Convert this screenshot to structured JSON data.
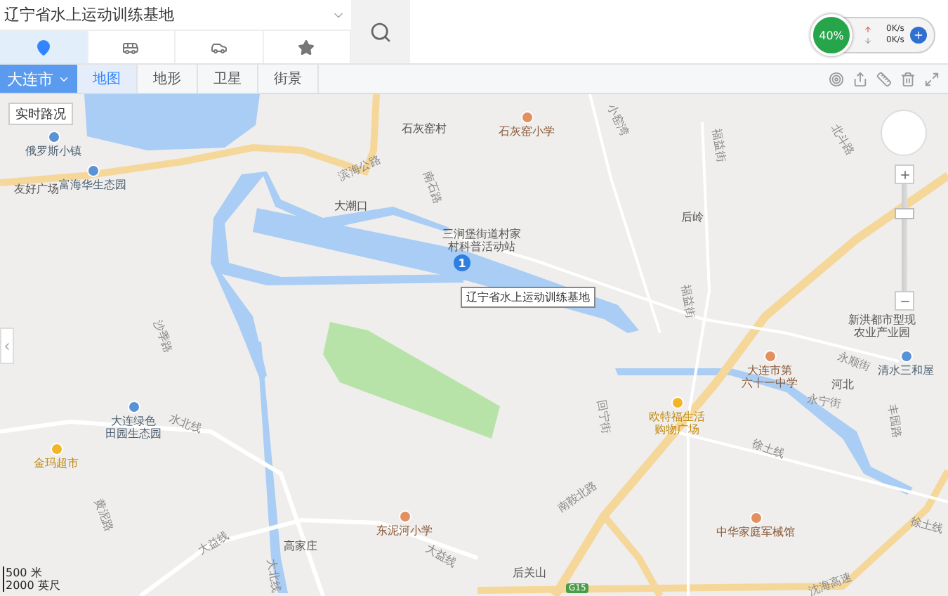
{
  "search": {
    "value": "辽宁省水上运动训练基地"
  },
  "modes": [
    {
      "kind": "pin",
      "selected": true
    },
    {
      "kind": "bus",
      "selected": false
    },
    {
      "kind": "car",
      "selected": false
    },
    {
      "kind": "star",
      "selected": false
    }
  ],
  "city": "大连市",
  "map_types": [
    {
      "label": "地图",
      "selected": true
    },
    {
      "label": "地形",
      "selected": false
    },
    {
      "label": "卫星",
      "selected": false
    },
    {
      "label": "街景",
      "selected": false
    }
  ],
  "traffic_button": "实时路况",
  "monitor": {
    "usage": "40%",
    "upload": "0K/s",
    "download": "0K/s"
  },
  "marker": {
    "number": "1",
    "tooltip": "辽宁省水上运动训练基地"
  },
  "labels": [
    {
      "kind": "place",
      "lines": [
        "石灰窑村"
      ]
    },
    {
      "kind": "school",
      "lines": [
        "石灰窑小学"
      ]
    },
    {
      "kind": "park",
      "lines": [
        "俄罗斯小镇"
      ]
    },
    {
      "kind": "park",
      "lines": [
        "富海华生态园"
      ]
    },
    {
      "kind": "place",
      "lines": [
        "友好广场"
      ]
    },
    {
      "kind": "road",
      "lines": [
        "滨海公路"
      ]
    },
    {
      "kind": "road",
      "lines": [
        "南石路"
      ]
    },
    {
      "kind": "road",
      "lines": [
        "小窑湾"
      ]
    },
    {
      "kind": "road",
      "lines": [
        "福益街"
      ]
    },
    {
      "kind": "road",
      "lines": [
        "北斗路"
      ]
    },
    {
      "kind": "place",
      "lines": [
        "大潮口"
      ]
    },
    {
      "kind": "place",
      "lines": [
        "三涧堡街道村家",
        "村科普活动站"
      ]
    },
    {
      "kind": "place",
      "lines": [
        "后岭"
      ]
    },
    {
      "kind": "road",
      "lines": [
        "福益街"
      ]
    },
    {
      "kind": "place",
      "lines": [
        "新洪都市型现",
        "农业产业园"
      ]
    },
    {
      "kind": "road",
      "lines": [
        "永顺街"
      ]
    },
    {
      "kind": "road",
      "lines": [
        "沙季路"
      ]
    },
    {
      "kind": "school",
      "lines": [
        "大连市第",
        "六十一中学"
      ]
    },
    {
      "kind": "road",
      "lines": [
        "永宁街"
      ]
    },
    {
      "kind": "place",
      "lines": [
        "河北"
      ]
    },
    {
      "kind": "park",
      "lines": [
        "清水三和屋"
      ]
    },
    {
      "kind": "road",
      "lines": [
        "水北线"
      ]
    },
    {
      "kind": "park",
      "lines": [
        "大连绿色",
        "田园生态园"
      ]
    },
    {
      "kind": "shop",
      "lines": [
        "金玛超市"
      ]
    },
    {
      "kind": "road",
      "lines": [
        "回宁街"
      ]
    },
    {
      "kind": "shop",
      "lines": [
        "欧特福生活",
        "购物广场"
      ]
    },
    {
      "kind": "road",
      "lines": [
        "丰园路"
      ]
    },
    {
      "kind": "road",
      "lines": [
        "徐土线"
      ]
    },
    {
      "kind": "road",
      "lines": [
        "徐土线"
      ]
    },
    {
      "kind": "road",
      "lines": [
        "黄泥路"
      ]
    },
    {
      "kind": "school",
      "lines": [
        "东泥河小学"
      ]
    },
    {
      "kind": "road",
      "lines": [
        "大益线"
      ]
    },
    {
      "kind": "road",
      "lines": [
        "大益线"
      ]
    },
    {
      "kind": "place",
      "lines": [
        "高家庄"
      ]
    },
    {
      "kind": "road",
      "lines": [
        "南鞍北路"
      ]
    },
    {
      "kind": "school",
      "lines": [
        "中华家庭军械馆"
      ]
    },
    {
      "kind": "place",
      "lines": [
        "后关山"
      ]
    },
    {
      "kind": "road",
      "lines": [
        "大北线"
      ]
    },
    {
      "kind": "road",
      "lines": [
        "沈海高速"
      ]
    }
  ],
  "highway_badge": "G15",
  "zoom": {
    "level": 0.75
  },
  "scale": {
    "metric": "500 米",
    "imperial": "2000 英尺"
  }
}
